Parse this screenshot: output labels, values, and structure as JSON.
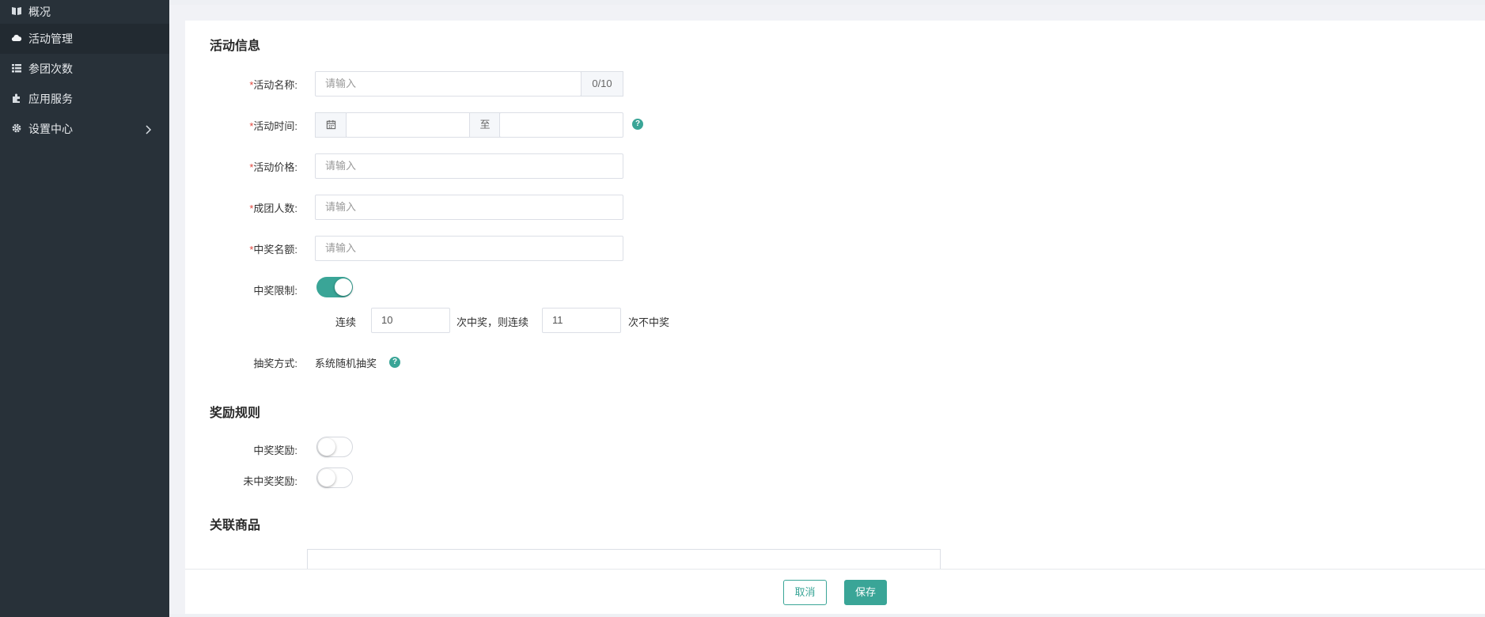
{
  "sidebar": {
    "items": [
      {
        "label": "概况",
        "icon": "book-icon"
      },
      {
        "label": "活动管理",
        "icon": "cloud-icon",
        "active": true
      },
      {
        "label": "参团次数",
        "icon": "list-icon"
      },
      {
        "label": "应用服务",
        "icon": "puzzle-icon"
      },
      {
        "label": "设置中心",
        "icon": "gear-icon",
        "has_submenu": true
      }
    ]
  },
  "activity_info": {
    "title": "活动信息",
    "required_mark": "*",
    "name": {
      "label": "活动名称:",
      "placeholder": "请输入",
      "counter": "0/10"
    },
    "time": {
      "label": "活动时间:",
      "separator": "至",
      "help": "?"
    },
    "price": {
      "label": "活动价格:",
      "placeholder": "请输入"
    },
    "group_size": {
      "label": "成团人数:",
      "placeholder": "请输入"
    },
    "winner_quota": {
      "label": "中奖名额:",
      "placeholder": "请输入"
    },
    "win_limit": {
      "label": "中奖限制:",
      "enabled": true,
      "prefix": "连续",
      "value1": "10",
      "middle": "次中奖，则连续",
      "value2": "11",
      "suffix": "次不中奖"
    },
    "draw_method": {
      "label": "抽奖方式:",
      "value": "系统随机抽奖",
      "help": "?"
    }
  },
  "reward_rules": {
    "title": "奖励规则",
    "win_reward": {
      "label": "中奖奖励:",
      "enabled": false
    },
    "lose_reward": {
      "label": "未中奖奖励:",
      "enabled": false
    }
  },
  "related_goods": {
    "title": "关联商品"
  },
  "footer": {
    "cancel_label": "取消",
    "save_label": "保存"
  },
  "colors": {
    "accent": "#3aa597",
    "sidebar_bg": "#283139",
    "required": "#e0473d"
  }
}
